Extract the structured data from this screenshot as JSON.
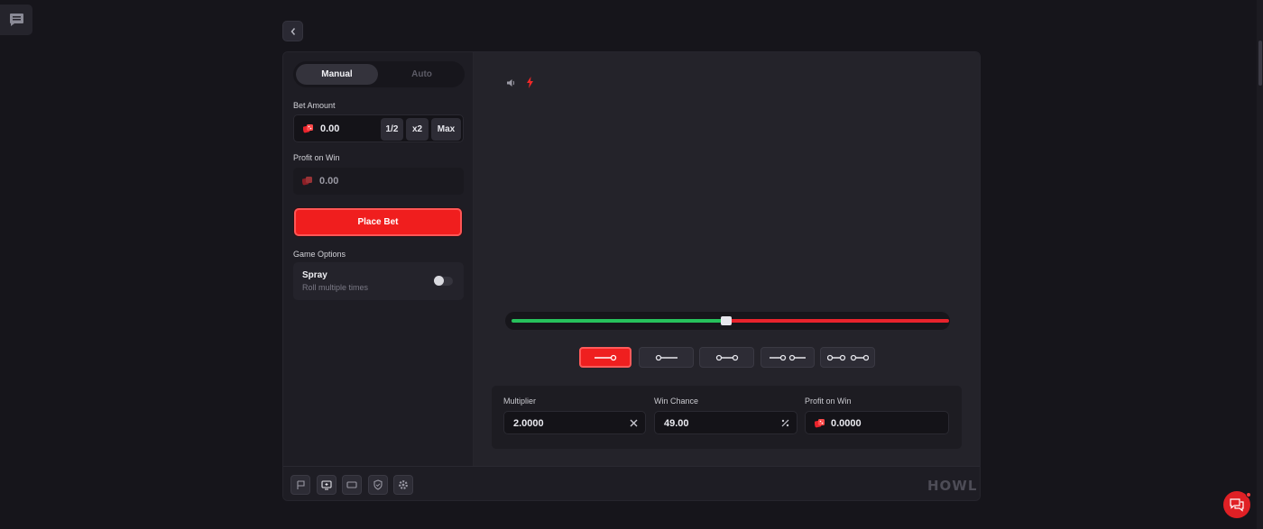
{
  "tabs": {
    "manual": "Manual",
    "auto": "Auto"
  },
  "bet": {
    "label": "Bet Amount",
    "value": "0.00",
    "half": "1/2",
    "double": "x2",
    "max": "Max"
  },
  "profit": {
    "label": "Profit on Win",
    "value": "0.00"
  },
  "place_bet": "Place Bet",
  "options": {
    "label": "Game Options",
    "spray_title": "Spray",
    "spray_sub": "Roll multiple times",
    "spray_enabled": false
  },
  "slider": {
    "value_fraction": 0.49,
    "left_color": "#27c15c",
    "right_color": "#e8232c"
  },
  "stats": {
    "multiplier_label": "Multiplier",
    "multiplier_value": "2.0000",
    "win_chance_label": "Win Chance",
    "win_chance_value": "49.00",
    "profit_label": "Profit on Win",
    "profit_value": "0.0000"
  },
  "mode_buttons": [
    "roll-over",
    "roll-under",
    "between",
    "outside",
    "double-between"
  ],
  "active_mode": 0,
  "footer_icons": [
    "flag-icon",
    "add-screen-icon",
    "theatre-mode-icon",
    "shield-icon",
    "gear-icon"
  ],
  "brand": "HOWL",
  "colors": {
    "accent": "#f01e1e",
    "background": "#16151b",
    "panel": "#1e1d24"
  }
}
